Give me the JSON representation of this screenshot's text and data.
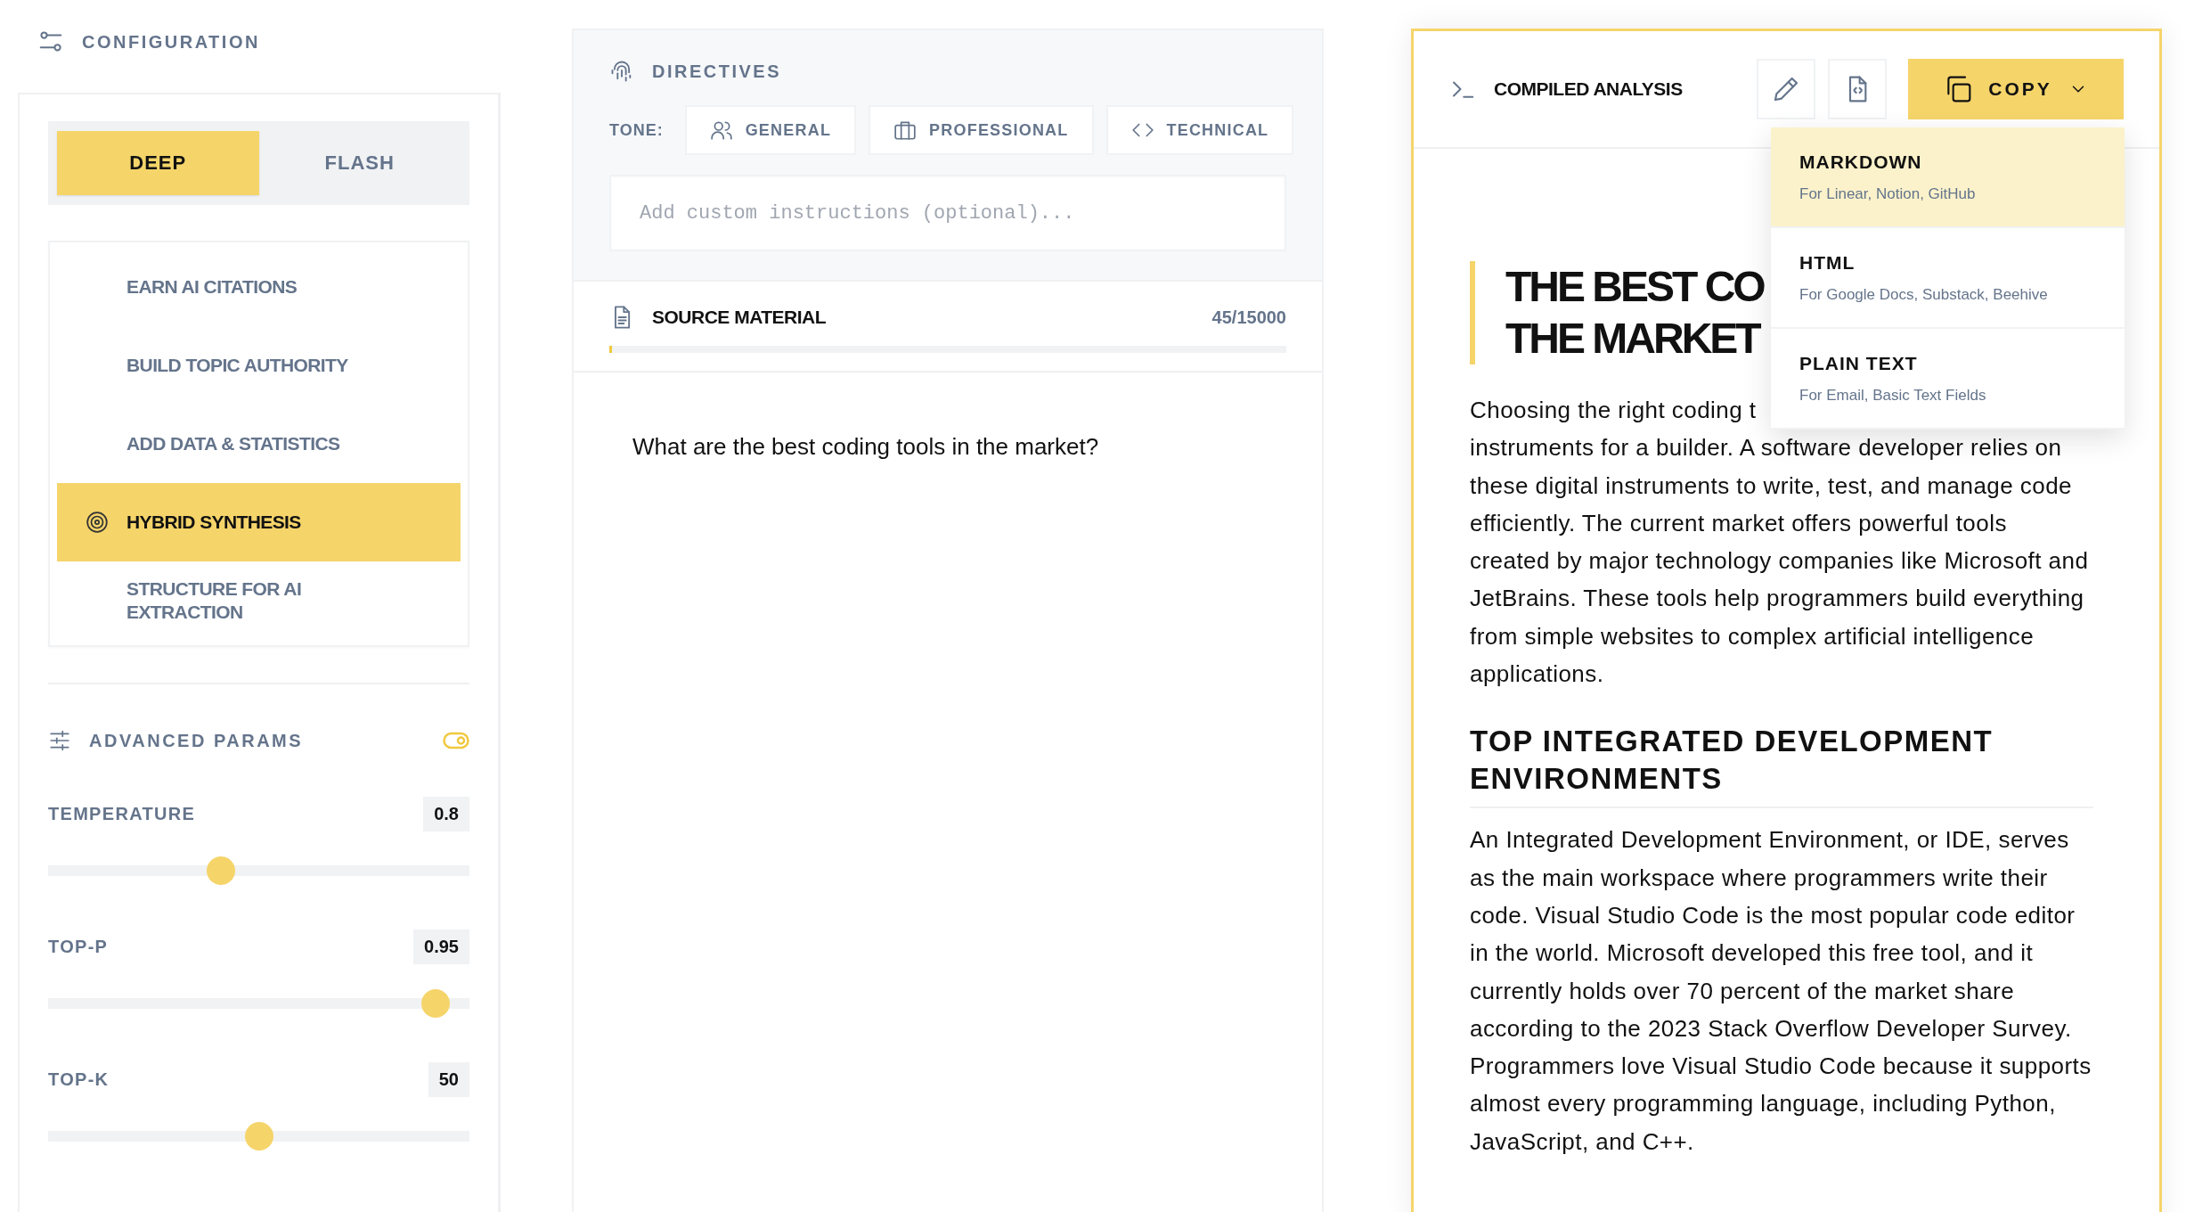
{
  "configuration": {
    "title": "CONFIGURATION",
    "modes": [
      {
        "label": "DEEP",
        "selected": true
      },
      {
        "label": "FLASH",
        "selected": false
      }
    ],
    "goals": [
      {
        "label": "EARN AI CITATIONS",
        "selected": false
      },
      {
        "label": "BUILD TOPIC AUTHORITY",
        "selected": false
      },
      {
        "label": "ADD DATA & STATISTICS",
        "selected": false
      },
      {
        "label": "HYBRID SYNTHESIS",
        "selected": true
      },
      {
        "label": "STRUCTURE FOR AI EXTRACTION",
        "selected": false
      }
    ],
    "advanced": {
      "title": "ADVANCED PARAMS",
      "on": true,
      "params": [
        {
          "label": "TEMPERATURE",
          "reading": "0.8",
          "level": 0.41
        },
        {
          "label": "TOP-P",
          "reading": "0.95",
          "level": 0.92
        },
        {
          "label": "TOP-K",
          "reading": "50",
          "level": 0.5
        }
      ]
    }
  },
  "directives": {
    "title": "DIRECTIVES",
    "tone_label": "TONE:",
    "tones": [
      {
        "kind": "people",
        "label": "GENERAL",
        "selected": false
      },
      {
        "kind": "briefcase",
        "label": "PROFESSIONAL",
        "selected": false
      },
      {
        "kind": "code",
        "label": "TECHNICAL",
        "selected": false
      }
    ],
    "instructions": {
      "placeholder": "Add custom instructions (optional)..."
    }
  },
  "source": {
    "title": "SOURCE MATERIAL",
    "count": "45/15000",
    "level": 0.003,
    "text": "What are the best coding tools in the market?"
  },
  "output": {
    "title": "COMPILED ANALYSIS",
    "copy_label": "COPY",
    "copy_menu": [
      {
        "label": "MARKDOWN",
        "hint": "For Linear, Notion, GitHub",
        "selected": true
      },
      {
        "label": "HTML",
        "hint": "For Google Docs, Substack, Beehive",
        "selected": false
      },
      {
        "label": "PLAIN TEXT",
        "hint": "For Email, Basic Text Fields",
        "selected": false
      }
    ],
    "heading_lines": [
      "THE BEST CO",
      "THE MARKET"
    ],
    "intro_first_line": "Choosing the right coding t",
    "intro_rest": "instruments for a builder. A software developer relies on these digital instruments to write, test, and manage code efficiently. The current market offers powerful tools created by major technology companies like Microsoft and JetBrains. These tools help programmers build everything from simple websites to complex artificial intelligence applications.",
    "section_heading": "TOP INTEGRATED DEVELOPMENT ENVIRONMENTS",
    "section_text": "An Integrated Development Environment, or IDE, serves as the main workspace where programmers write their code. Visual Studio Code is the most popular code editor in the world. Microsoft developed this free tool, and it currently holds over 70 percent of the market share according to the 2023 Stack Overflow Developer Survey. Programmers love Visual Studio Code because it supports almost every programming language, including Python, JavaScript, and C++."
  }
}
